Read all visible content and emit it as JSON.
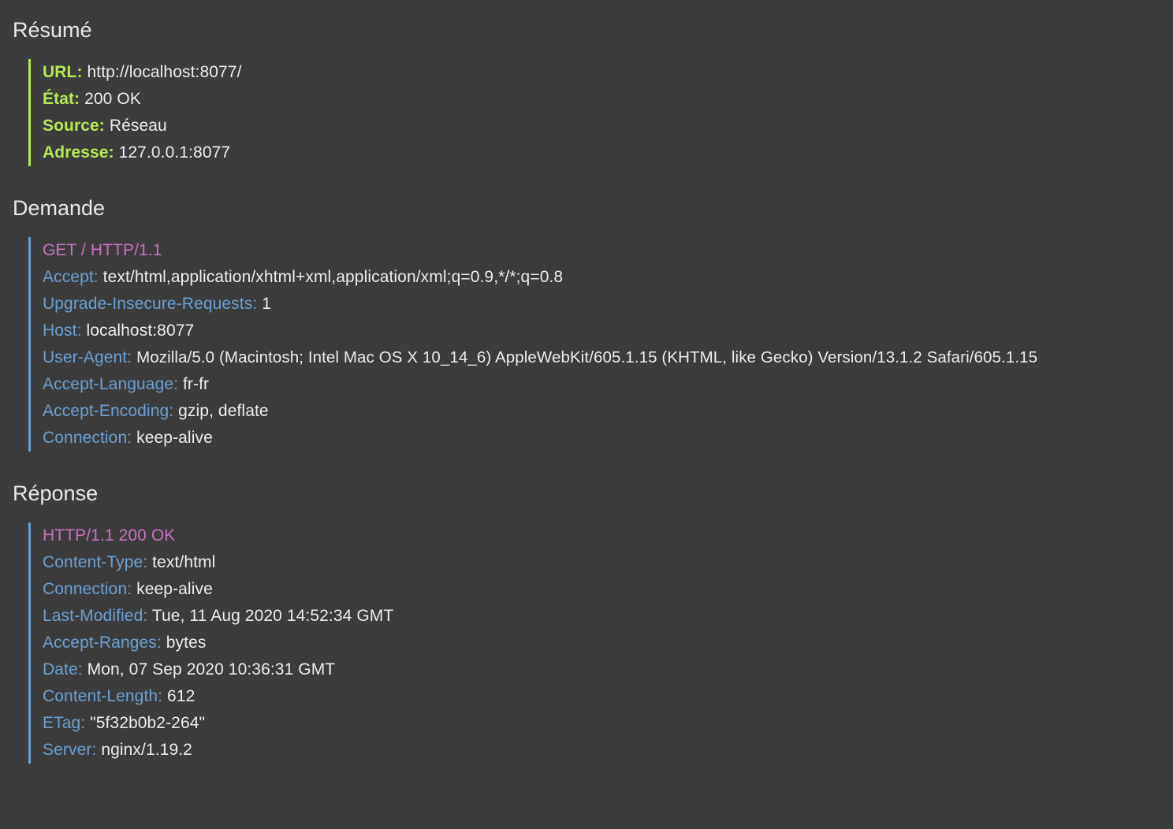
{
  "sections": {
    "summary": {
      "title": "Résumé",
      "rows": [
        {
          "key": "URL:",
          "value": "http://localhost:8077/"
        },
        {
          "key": "État:",
          "value": "200 OK"
        },
        {
          "key": "Source:",
          "value": "Réseau"
        },
        {
          "key": "Adresse:",
          "value": "127.0.0.1:8077"
        }
      ]
    },
    "request": {
      "title": "Demande",
      "start_line": "GET / HTTP/1.1",
      "headers": [
        {
          "key": "Accept:",
          "value": "text/html,application/xhtml+xml,application/xml;q=0.9,*/*;q=0.8"
        },
        {
          "key": "Upgrade-Insecure-Requests:",
          "value": "1"
        },
        {
          "key": "Host:",
          "value": "localhost:8077"
        },
        {
          "key": "User-Agent:",
          "value": "Mozilla/5.0 (Macintosh; Intel Mac OS X 10_14_6) AppleWebKit/605.1.15 (KHTML, like Gecko) Version/13.1.2 Safari/605.1.15"
        },
        {
          "key": "Accept-Language:",
          "value": "fr-fr"
        },
        {
          "key": "Accept-Encoding:",
          "value": "gzip, deflate"
        },
        {
          "key": "Connection:",
          "value": "keep-alive"
        }
      ]
    },
    "response": {
      "title": "Réponse",
      "start_line": "HTTP/1.1 200 OK",
      "headers": [
        {
          "key": "Content-Type:",
          "value": "text/html"
        },
        {
          "key": "Connection:",
          "value": "keep-alive"
        },
        {
          "key": "Last-Modified:",
          "value": "Tue, 11 Aug 2020 14:52:34 GMT"
        },
        {
          "key": "Accept-Ranges:",
          "value": "bytes"
        },
        {
          "key": "Date:",
          "value": "Mon, 07 Sep 2020 10:36:31 GMT"
        },
        {
          "key": "Content-Length:",
          "value": "612"
        },
        {
          "key": "ETag:",
          "value": "\"5f32b0b2-264\""
        },
        {
          "key": "Server:",
          "value": "nginx/1.19.2"
        }
      ]
    }
  },
  "colors": {
    "background": "#3c3c3c",
    "summary_key": "#b5e853",
    "header_key": "#6a9fd2",
    "start_line": "#c770c0",
    "text": "#ececec"
  }
}
